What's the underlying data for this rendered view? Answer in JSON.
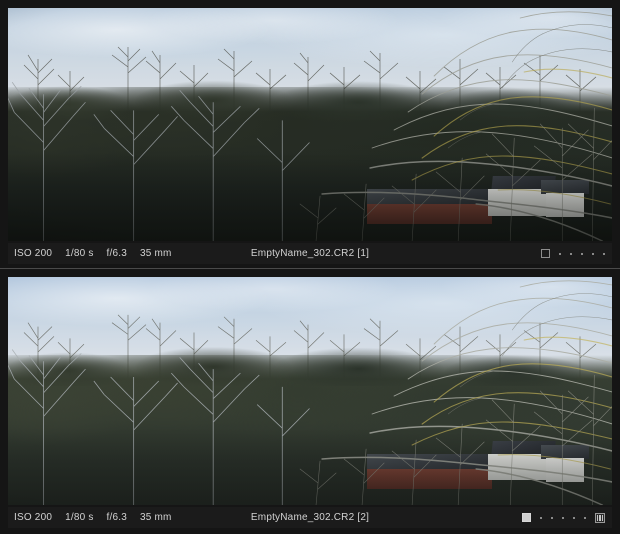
{
  "app": {
    "view_mode": "compare",
    "background_color": "#1c1c1c",
    "info_bar_color": "#1b1b1b",
    "text_color": "#d2d2d2"
  },
  "panels": [
    {
      "index": "1",
      "name": "top-compare-pane",
      "filename": "EmptyName_302.CR2 [1]",
      "exif": {
        "iso": "ISO 200",
        "shutter": "1/80 s",
        "aperture": "f/6.3",
        "focal_length": "35 mm"
      },
      "rating": {
        "flag": "square-outline",
        "flag_filled": false,
        "dots": 5,
        "has_columns_icon": false
      },
      "photo": {
        "subject": "winter woodland hillside with farm buildings and bare foreground branches",
        "rendition": "darker",
        "sky_color": "#cdd8e2",
        "foliage_color": "#262c23"
      }
    },
    {
      "index": "2",
      "name": "bottom-compare-pane",
      "filename": "EmptyName_302.CR2 [2]",
      "exif": {
        "iso": "ISO 200",
        "shutter": "1/80 s",
        "aperture": "f/6.3",
        "focal_length": "35 mm"
      },
      "rating": {
        "flag": "square-filled",
        "flag_filled": true,
        "dots": 5,
        "has_columns_icon": true
      },
      "photo": {
        "subject": "winter woodland hillside with farm buildings and bare foreground branches",
        "rendition": "brighter",
        "sky_color": "#d8dfe7",
        "foliage_color": "#343c30"
      }
    }
  ]
}
